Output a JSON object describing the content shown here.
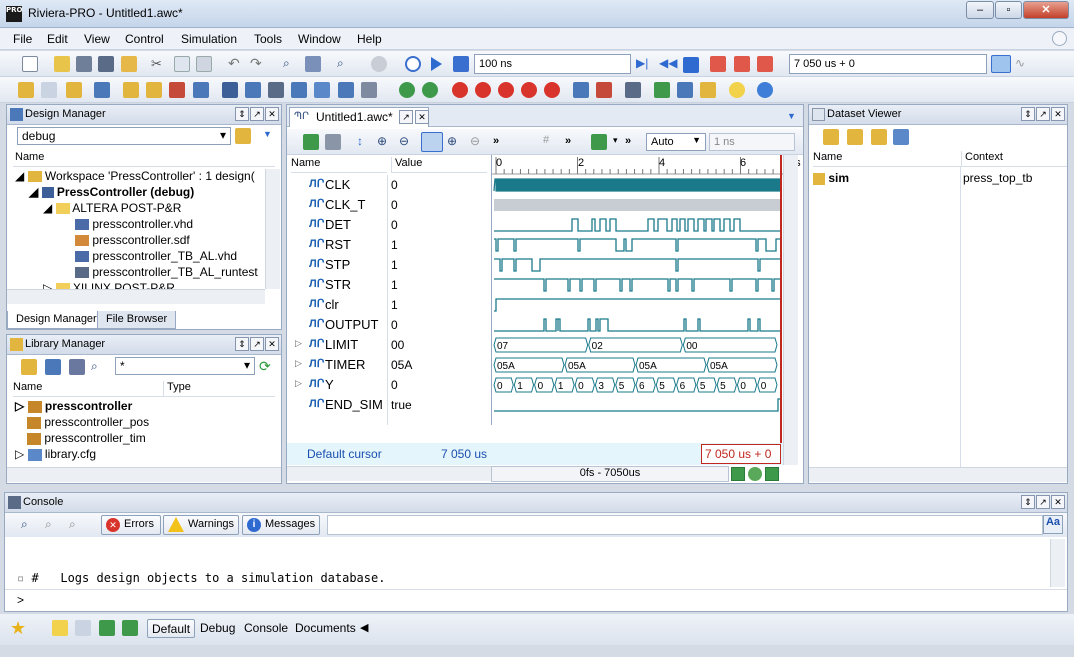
{
  "window": {
    "title": "Riviera-PRO - Untitled1.awc*",
    "logo": "PRO"
  },
  "menu": [
    "File",
    "Edit",
    "View",
    "Control",
    "Simulation",
    "Tools",
    "Window",
    "Help"
  ],
  "toolbar": {
    "run_time": "100 ns",
    "sim_time": "7 050 us + 0"
  },
  "design_manager": {
    "title": "Design Manager",
    "config": "debug",
    "column": "Name",
    "tree": [
      "Workspace 'PressController' : 1 design(",
      "PressController (debug)",
      "ALTERA POST-P&R",
      "presscontroller.vhd",
      "presscontroller.sdf",
      "presscontroller_TB_AL.vhd",
      "presscontroller_TB_AL_runtest",
      "XILINX POST-P&R"
    ],
    "tabs": [
      "Design Manager",
      "File Browser"
    ]
  },
  "library_manager": {
    "title": "Library Manager",
    "filter": "*",
    "columns": [
      "Name",
      "Type"
    ],
    "items": [
      "presscontroller",
      "presscontroller_pos",
      "presscontroller_tim",
      "library.cfg"
    ]
  },
  "waveform": {
    "tab": "Untitled1.awc*",
    "zoom_mode": "Auto",
    "step": "1 ns",
    "columns": [
      "Name",
      "Value"
    ],
    "timeline": [
      "0",
      "2",
      "4",
      "6"
    ],
    "unit": "ms",
    "signals": [
      {
        "name": "CLK",
        "value": "0",
        "kind": "clk"
      },
      {
        "name": "CLK_T",
        "value": "0",
        "kind": "flat"
      },
      {
        "name": "DET",
        "value": "0",
        "kind": "bit"
      },
      {
        "name": "RST",
        "value": "1",
        "kind": "bit"
      },
      {
        "name": "STP",
        "value": "1",
        "kind": "bit"
      },
      {
        "name": "STR",
        "value": "1",
        "kind": "bit"
      },
      {
        "name": "clr",
        "value": "1",
        "kind": "bit"
      },
      {
        "name": "OUTPUT",
        "value": "0",
        "kind": "bit"
      },
      {
        "name": "LIMIT",
        "value": "00",
        "kind": "bus"
      },
      {
        "name": "TIMER",
        "value": "05A",
        "kind": "bus"
      },
      {
        "name": "Y",
        "value": "0",
        "kind": "bus"
      },
      {
        "name": "END_SIM",
        "value": "true",
        "kind": "bit"
      }
    ],
    "bus_labels": {
      "LIMIT": [
        "07",
        "02",
        "00"
      ],
      "TIMER": [
        "05A",
        "05A",
        "05A",
        "05A"
      ],
      "Y": [
        "0",
        "1",
        "0",
        "1",
        "0",
        "3",
        "5",
        "6",
        "5",
        "6",
        "5",
        "5",
        "0",
        "0"
      ]
    },
    "cursor_label": "Default cursor",
    "cursor_time": "7 050 us",
    "cursor_readout": "7 050 us + 0",
    "range": "0fs - 7050us"
  },
  "dataset_viewer": {
    "title": "Dataset Viewer",
    "columns": [
      "Name",
      "Context"
    ],
    "rows": [
      {
        "name": "sim",
        "context": "press_top_tb"
      }
    ]
  },
  "console": {
    "title": "Console",
    "filters": [
      "Errors",
      "Warnings",
      "Messages"
    ],
    "lines": [
      "#   Logs design objects to a simulation database.",
      "#"
    ],
    "prompt": ">",
    "bottom_tabs": [
      "Default",
      "Debug",
      "Console",
      "Documents"
    ]
  }
}
